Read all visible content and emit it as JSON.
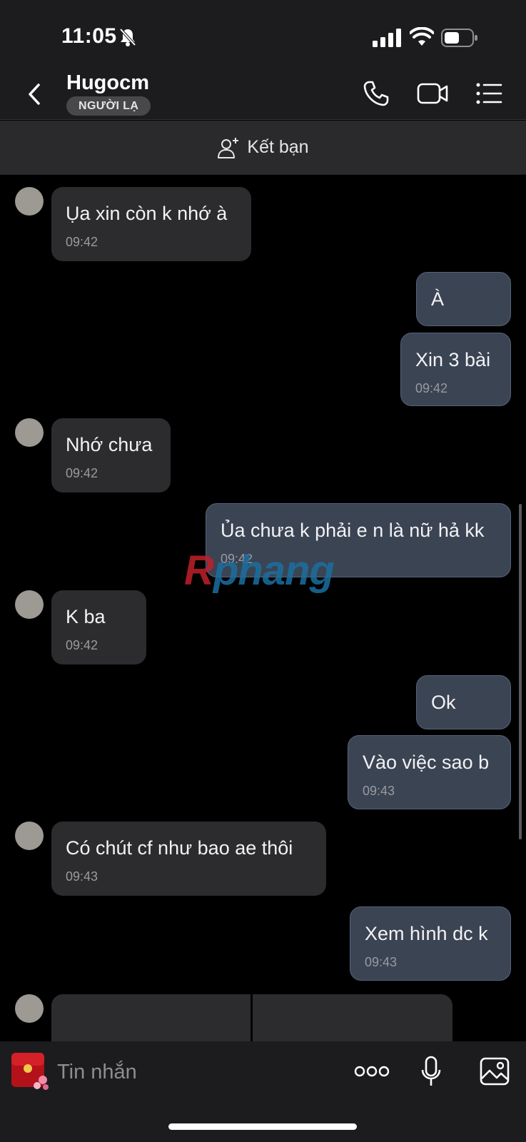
{
  "status_bar": {
    "time": "11:05"
  },
  "header": {
    "contact_name": "Hugocm",
    "badge": "NGƯỜI LẠ"
  },
  "friend_bar": {
    "label": "Kết bạn"
  },
  "messages": [
    {
      "dir": "in",
      "text": "Ụa xin còn k nhớ à",
      "time": "09:42"
    },
    {
      "dir": "out",
      "text": "À",
      "time": ""
    },
    {
      "dir": "out",
      "text": "Xin 3 bài",
      "time": "09:42"
    },
    {
      "dir": "in",
      "text": "Nhớ chưa",
      "time": "09:42"
    },
    {
      "dir": "out",
      "text": "Ủa chưa k phải e n là nữ hả kk",
      "time": "09:42"
    },
    {
      "dir": "in",
      "text": "K ba",
      "time": "09:42"
    },
    {
      "dir": "out",
      "text": "Ok",
      "time": ""
    },
    {
      "dir": "out",
      "text": "Vào việc sao b",
      "time": "09:43"
    },
    {
      "dir": "in",
      "text": "Có chút cf như bao ae thôi",
      "time": "09:43"
    },
    {
      "dir": "out",
      "text": "Xem hình dc k",
      "time": "09:43"
    }
  ],
  "watermark": {
    "first": "R",
    "rest": "phang"
  },
  "input_bar": {
    "placeholder": "Tin nhắn"
  },
  "colors": {
    "incoming_bubble": "#2c2c2e",
    "outgoing_bubble": "#3b4453",
    "background": "#000000"
  },
  "icons": [
    "bell-off-icon",
    "signal-icon",
    "wifi-icon",
    "battery-icon",
    "back-icon",
    "phone-icon",
    "video-icon",
    "list-icon",
    "add-friend-icon",
    "sticker-icon",
    "more-icon",
    "mic-icon",
    "image-icon"
  ]
}
